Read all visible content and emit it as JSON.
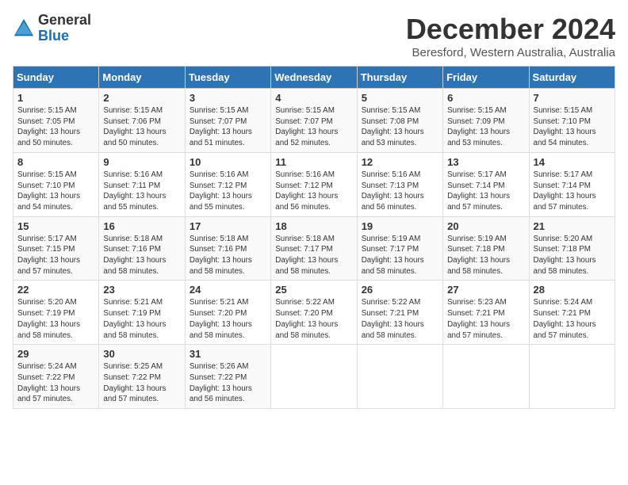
{
  "header": {
    "logo_line1": "General",
    "logo_line2": "Blue",
    "title": "December 2024",
    "subtitle": "Beresford, Western Australia, Australia"
  },
  "calendar": {
    "days_of_week": [
      "Sunday",
      "Monday",
      "Tuesday",
      "Wednesday",
      "Thursday",
      "Friday",
      "Saturday"
    ],
    "weeks": [
      [
        {
          "day": "1",
          "info": "Sunrise: 5:15 AM\nSunset: 7:05 PM\nDaylight: 13 hours\nand 50 minutes."
        },
        {
          "day": "2",
          "info": "Sunrise: 5:15 AM\nSunset: 7:06 PM\nDaylight: 13 hours\nand 50 minutes."
        },
        {
          "day": "3",
          "info": "Sunrise: 5:15 AM\nSunset: 7:07 PM\nDaylight: 13 hours\nand 51 minutes."
        },
        {
          "day": "4",
          "info": "Sunrise: 5:15 AM\nSunset: 7:07 PM\nDaylight: 13 hours\nand 52 minutes."
        },
        {
          "day": "5",
          "info": "Sunrise: 5:15 AM\nSunset: 7:08 PM\nDaylight: 13 hours\nand 53 minutes."
        },
        {
          "day": "6",
          "info": "Sunrise: 5:15 AM\nSunset: 7:09 PM\nDaylight: 13 hours\nand 53 minutes."
        },
        {
          "day": "7",
          "info": "Sunrise: 5:15 AM\nSunset: 7:10 PM\nDaylight: 13 hours\nand 54 minutes."
        }
      ],
      [
        {
          "day": "8",
          "info": "Sunrise: 5:15 AM\nSunset: 7:10 PM\nDaylight: 13 hours\nand 54 minutes."
        },
        {
          "day": "9",
          "info": "Sunrise: 5:16 AM\nSunset: 7:11 PM\nDaylight: 13 hours\nand 55 minutes."
        },
        {
          "day": "10",
          "info": "Sunrise: 5:16 AM\nSunset: 7:12 PM\nDaylight: 13 hours\nand 55 minutes."
        },
        {
          "day": "11",
          "info": "Sunrise: 5:16 AM\nSunset: 7:12 PM\nDaylight: 13 hours\nand 56 minutes."
        },
        {
          "day": "12",
          "info": "Sunrise: 5:16 AM\nSunset: 7:13 PM\nDaylight: 13 hours\nand 56 minutes."
        },
        {
          "day": "13",
          "info": "Sunrise: 5:17 AM\nSunset: 7:14 PM\nDaylight: 13 hours\nand 57 minutes."
        },
        {
          "day": "14",
          "info": "Sunrise: 5:17 AM\nSunset: 7:14 PM\nDaylight: 13 hours\nand 57 minutes."
        }
      ],
      [
        {
          "day": "15",
          "info": "Sunrise: 5:17 AM\nSunset: 7:15 PM\nDaylight: 13 hours\nand 57 minutes."
        },
        {
          "day": "16",
          "info": "Sunrise: 5:18 AM\nSunset: 7:16 PM\nDaylight: 13 hours\nand 58 minutes."
        },
        {
          "day": "17",
          "info": "Sunrise: 5:18 AM\nSunset: 7:16 PM\nDaylight: 13 hours\nand 58 minutes."
        },
        {
          "day": "18",
          "info": "Sunrise: 5:18 AM\nSunset: 7:17 PM\nDaylight: 13 hours\nand 58 minutes."
        },
        {
          "day": "19",
          "info": "Sunrise: 5:19 AM\nSunset: 7:17 PM\nDaylight: 13 hours\nand 58 minutes."
        },
        {
          "day": "20",
          "info": "Sunrise: 5:19 AM\nSunset: 7:18 PM\nDaylight: 13 hours\nand 58 minutes."
        },
        {
          "day": "21",
          "info": "Sunrise: 5:20 AM\nSunset: 7:18 PM\nDaylight: 13 hours\nand 58 minutes."
        }
      ],
      [
        {
          "day": "22",
          "info": "Sunrise: 5:20 AM\nSunset: 7:19 PM\nDaylight: 13 hours\nand 58 minutes."
        },
        {
          "day": "23",
          "info": "Sunrise: 5:21 AM\nSunset: 7:19 PM\nDaylight: 13 hours\nand 58 minutes."
        },
        {
          "day": "24",
          "info": "Sunrise: 5:21 AM\nSunset: 7:20 PM\nDaylight: 13 hours\nand 58 minutes."
        },
        {
          "day": "25",
          "info": "Sunrise: 5:22 AM\nSunset: 7:20 PM\nDaylight: 13 hours\nand 58 minutes."
        },
        {
          "day": "26",
          "info": "Sunrise: 5:22 AM\nSunset: 7:21 PM\nDaylight: 13 hours\nand 58 minutes."
        },
        {
          "day": "27",
          "info": "Sunrise: 5:23 AM\nSunset: 7:21 PM\nDaylight: 13 hours\nand 57 minutes."
        },
        {
          "day": "28",
          "info": "Sunrise: 5:24 AM\nSunset: 7:21 PM\nDaylight: 13 hours\nand 57 minutes."
        }
      ],
      [
        {
          "day": "29",
          "info": "Sunrise: 5:24 AM\nSunset: 7:22 PM\nDaylight: 13 hours\nand 57 minutes."
        },
        {
          "day": "30",
          "info": "Sunrise: 5:25 AM\nSunset: 7:22 PM\nDaylight: 13 hours\nand 57 minutes."
        },
        {
          "day": "31",
          "info": "Sunrise: 5:26 AM\nSunset: 7:22 PM\nDaylight: 13 hours\nand 56 minutes."
        },
        null,
        null,
        null,
        null
      ]
    ]
  }
}
